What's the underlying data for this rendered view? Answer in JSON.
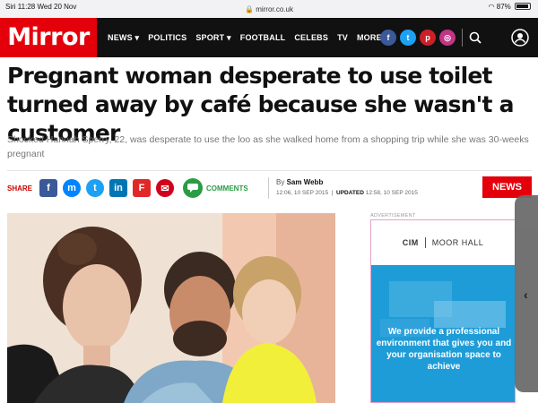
{
  "status_bar": {
    "assistant": "Siri",
    "time": "11:28",
    "date": "Wed 20 Nov",
    "url": "mirror.co.uk",
    "battery": "87%"
  },
  "nav": {
    "logo": "Mirror",
    "items": [
      "NEWS ▾",
      "POLITICS",
      "SPORT ▾",
      "FOOTBALL",
      "CELEBS",
      "TV",
      "MORE ▾"
    ],
    "social": [
      {
        "icon": "facebook-icon",
        "glyph": "f",
        "color": "#3b5998"
      },
      {
        "icon": "twitter-icon",
        "glyph": "t",
        "color": "#1da1f2"
      },
      {
        "icon": "pinterest-icon",
        "glyph": "p",
        "color": "#cb2027"
      },
      {
        "icon": "instagram-icon",
        "glyph": "◎",
        "color": "#c13584"
      }
    ]
  },
  "article": {
    "headline": "Pregnant woman desperate to use toilet turned away by café because she wasn't a customer",
    "standfirst": "Shocked Hannah Sperry, 22, was desperate to use the loo as she walked home from a shopping trip while she was 30-weeks pregnant",
    "share_label": "SHARE",
    "share_buttons": [
      {
        "icon": "facebook-share-icon",
        "glyph": "f",
        "color": "#3b5998"
      },
      {
        "icon": "messenger-share-icon",
        "glyph": "m",
        "color": "#0084ff"
      },
      {
        "icon": "twitter-share-icon",
        "glyph": "t",
        "color": "#1da1f2"
      },
      {
        "icon": "linkedin-share-icon",
        "glyph": "in",
        "color": "#0077b5"
      },
      {
        "icon": "flipboard-share-icon",
        "glyph": "F",
        "color": "#e12828"
      },
      {
        "icon": "email-share-icon",
        "glyph": "✉",
        "color": "#d0021b"
      }
    ],
    "comments_label": "COMMENTS",
    "byline_prefix": "By",
    "author": "Sam Webb",
    "published": "12:06, 10 SEP 2015",
    "updated_label": "UPDATED",
    "updated": "12:58, 10 SEP 2015",
    "section_tag": "NEWS"
  },
  "ad": {
    "label": "ADVERTISEMENT",
    "brand_left": "CIM",
    "brand_right": "MOOR HALL",
    "text": "We provide a professional environment that gives you and your organisation space to achieve"
  },
  "colors": {
    "brand": "#e4000b",
    "nav_bg": "#111111",
    "comments_green": "#2a9d44",
    "ad_blue": "#1e9cd7"
  }
}
